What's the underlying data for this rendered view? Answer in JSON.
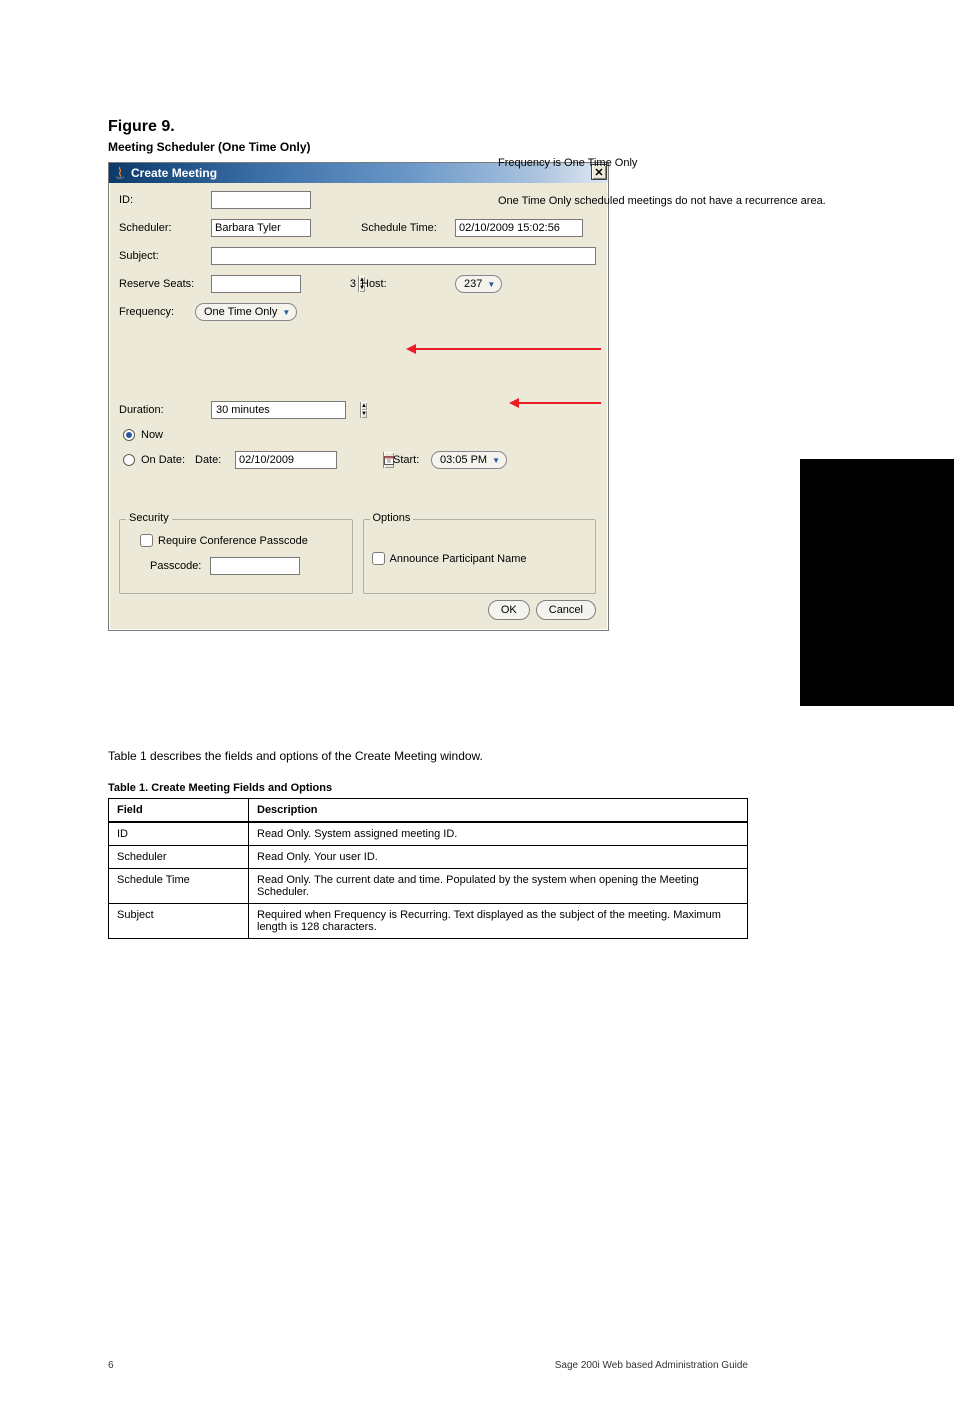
{
  "page_heading": {
    "line1": "Figure 9.",
    "line2": "Meeting Scheduler (One Time Only)"
  },
  "dialog": {
    "title": "Create Meeting",
    "labels": {
      "id": "ID:",
      "scheduler": "Scheduler:",
      "schedule_time": "Schedule Time:",
      "subject": "Subject:",
      "reserve_seats": "Reserve Seats:",
      "host": "Host:",
      "frequency": "Frequency:",
      "duration": "Duration:",
      "now": "Now",
      "on_date": "On Date:",
      "date": "Date:",
      "start": "Start:",
      "security": "Security",
      "require_passcode": "Require Conference Passcode",
      "passcode": "Passcode:",
      "options": "Options",
      "announce": "Announce Participant Name",
      "ok": "OK",
      "cancel": "Cancel"
    },
    "values": {
      "id": "",
      "scheduler": "Barbara Tyler",
      "schedule_time": "02/10/2009 15:02:56",
      "subject": "",
      "reserve_seats": "3",
      "host": "237",
      "frequency": "One Time Only",
      "duration": "30 minutes",
      "on_date_value": "02/10/2009",
      "start_value": "03:05 PM",
      "passcode": ""
    }
  },
  "annotations": {
    "arrow1_text": "Frequency is One Time Only",
    "arrow2_text": "One Time Only scheduled meetings do not have a recurrence area."
  },
  "intro_text": "Table 1 describes the fields and options of the Create Meeting window.",
  "table": {
    "caption": "Table 1. Create Meeting Fields and Options",
    "head": [
      "Field",
      "Description"
    ],
    "rows": [
      [
        "ID",
        "Read Only. System assigned meeting ID."
      ],
      [
        "Scheduler",
        "Read Only. Your user ID."
      ],
      [
        "Schedule Time",
        "Read Only. The current date and time. Populated by the system when opening the Meeting Scheduler."
      ],
      [
        "Subject",
        "Required when Frequency is Recurring. Text displayed as the subject of the meeting. Maximum length is 128 characters."
      ]
    ]
  },
  "footer": {
    "left": "6",
    "right": "Sage 200i Web based Administration Guide"
  }
}
